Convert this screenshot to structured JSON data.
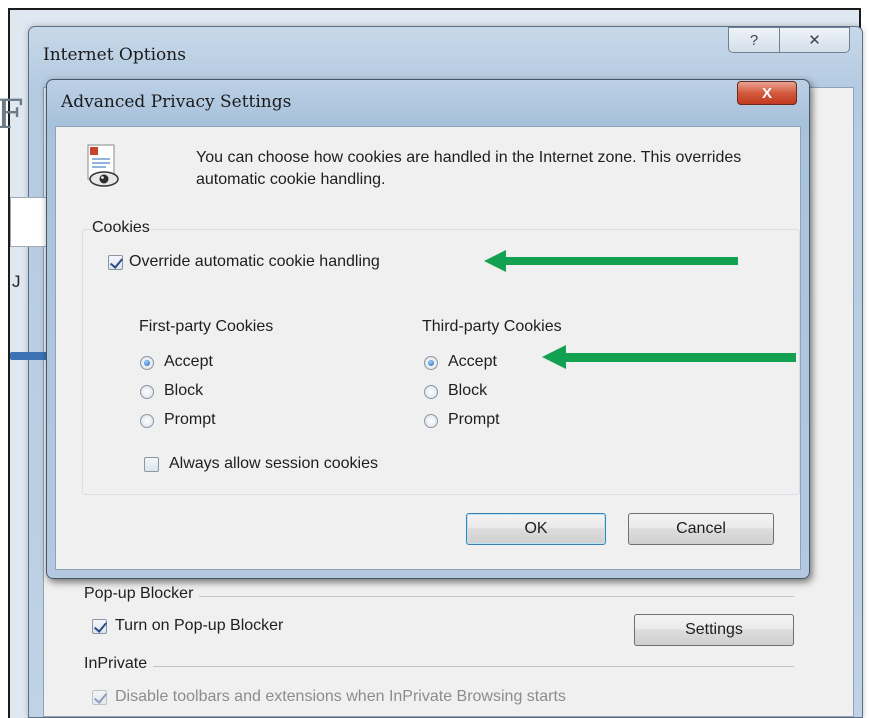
{
  "internet_options": {
    "title": "Internet Options",
    "help_glyph": "?",
    "close_glyph": "✕",
    "bg_heading_glyph": "F",
    "bg_letter": "J",
    "popup_blocker": {
      "group_label": "Pop-up Blocker",
      "checkbox_label": "Turn on Pop-up Blocker",
      "checked": true,
      "settings_button": "Settings"
    },
    "inprivate": {
      "group_label": "InPrivate",
      "checkbox_label": "Disable toolbars and extensions when InPrivate Browsing starts",
      "checked": true,
      "disabled": true
    }
  },
  "advanced_privacy": {
    "title": "Advanced Privacy Settings",
    "close_glyph": "X",
    "info_text": "You can choose how cookies are handled in the Internet zone.  This overrides automatic cookie handling.",
    "cookies_label": "Cookies",
    "override": {
      "label": "Override automatic cookie handling",
      "checked": true
    },
    "first_party": {
      "heading": "First-party Cookies",
      "options": [
        "Accept",
        "Block",
        "Prompt"
      ],
      "selected": "Accept"
    },
    "third_party": {
      "heading": "Third-party Cookies",
      "options": [
        "Accept",
        "Block",
        "Prompt"
      ],
      "selected": "Accept"
    },
    "session_cookies": {
      "label": "Always allow session cookies",
      "checked": false
    },
    "ok_button": "OK",
    "cancel_button": "Cancel"
  },
  "annotation_color": "#12a150"
}
